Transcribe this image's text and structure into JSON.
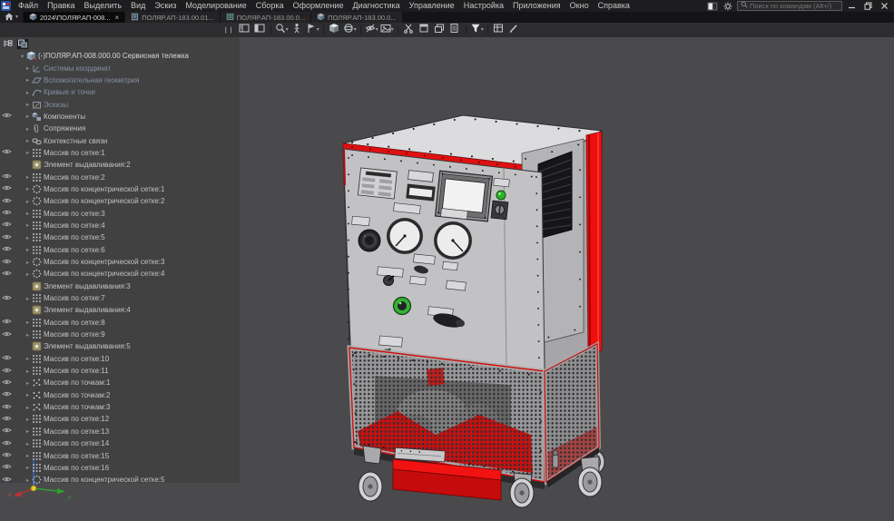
{
  "window": {
    "menu": [
      "Файл",
      "Правка",
      "Выделить",
      "Вид",
      "Эскиз",
      "Моделирование",
      "Сборка",
      "Оформление",
      "Диагностика",
      "Управление",
      "Настройка",
      "Приложения",
      "Окно",
      "Справка"
    ],
    "search": {
      "placeholder": "Поиск по командам (Alt+/)",
      "icon": "search-icon"
    },
    "titlebar_icons": [
      {
        "name": "layout-toggle-icon"
      },
      {
        "name": "settings-gear-icon"
      }
    ],
    "controls": [
      {
        "name": "minimize-icon"
      },
      {
        "name": "maximize-icon"
      },
      {
        "name": "close-icon"
      }
    ]
  },
  "tabs": {
    "home_icon": "home-icon",
    "items": [
      {
        "label": "2024\\ПОЛЯР.АП-008...",
        "icon": "assembly-doc-icon",
        "active": true,
        "close_glyph": "×"
      },
      {
        "label": "ПОЛЯР.АП-183.00.01...",
        "icon": "part-doc-icon",
        "active": false
      },
      {
        "label": "ПОЛЯР.АП-183.00.0...",
        "icon": "drawing-doc-icon",
        "active": false
      },
      {
        "label": "ПОЛЯР.АП-183.00.0...",
        "icon": "assembly-doc-icon",
        "active": false
      }
    ]
  },
  "toolbar": {
    "items": [
      {
        "name": "panel-drag-handle",
        "handle": true
      },
      {
        "name": "tree-panel-icon"
      },
      {
        "name": "graphic-layout-icon"
      },
      {
        "sep": true
      },
      {
        "name": "zoom-icon",
        "caret": true
      },
      {
        "name": "walk-icon"
      },
      {
        "name": "orientation-arrow-icon",
        "caret": true
      },
      {
        "sep": true
      },
      {
        "name": "shaded-cube-icon"
      },
      {
        "name": "orbit-sphere-icon",
        "caret": true
      },
      {
        "sep": true
      },
      {
        "name": "hide-objects-eye-icon",
        "caret": true
      },
      {
        "name": "snapshot-image-icon",
        "caret": true
      },
      {
        "sep": true
      },
      {
        "name": "explode-scissors-icon"
      },
      {
        "name": "window-new-icon"
      },
      {
        "name": "window-cascade-icon"
      },
      {
        "name": "window-docs-icon"
      },
      {
        "sep": true
      },
      {
        "name": "filter-funnel-icon",
        "caret": true
      },
      {
        "sep": true
      },
      {
        "name": "properties-table-icon"
      },
      {
        "name": "style-pencil-icon"
      }
    ]
  },
  "tree": {
    "header_icons": [
      {
        "name": "tree-structure-toggle-icon",
        "active": false
      },
      {
        "name": "tree-composition-toggle-icon",
        "active": true
      }
    ],
    "items": [
      {
        "label": "(-)ПОЛЯР.АП-008.000.00 Сервисная тележка",
        "icon": "assembly-icon",
        "root": true,
        "arrow": "down",
        "eye": false,
        "dimmed": false
      },
      {
        "label": "Системы координат",
        "icon": "coordinate-systems-icon",
        "arrow": "right",
        "eye": false,
        "dimmed": true
      },
      {
        "label": "Вспомогательная геометрия",
        "icon": "aux-geometry-icon",
        "arrow": "right",
        "eye": false,
        "dimmed": true
      },
      {
        "label": "Кривые и точки",
        "icon": "curves-points-icon",
        "arrow": "right",
        "eye": false,
        "dimmed": true
      },
      {
        "label": "Эскизы",
        "icon": "sketches-icon",
        "arrow": "right",
        "eye": false,
        "dimmed": true
      },
      {
        "label": "Компоненты",
        "icon": "components-icon",
        "arrow": "right",
        "eye": true,
        "dimmed": false
      },
      {
        "label": "Сопряжения",
        "icon": "mates-icon",
        "arrow": "right",
        "eye": false,
        "dimmed": false
      },
      {
        "label": "Контекстные связи",
        "icon": "context-links-icon",
        "arrow": "right",
        "eye": false,
        "dimmed": false
      },
      {
        "label": "Массив по сетке:1",
        "icon": "grid-array-icon",
        "arrow": "right",
        "eye": true,
        "dimmed": false
      },
      {
        "label": "Элемент выдавливания:2",
        "icon": "extrude-icon",
        "arrow": null,
        "eye": false,
        "dimmed": false
      },
      {
        "label": "Массив по сетке:2",
        "icon": "grid-array-icon",
        "arrow": "right",
        "eye": true,
        "dimmed": false
      },
      {
        "label": "Массив по концентрической сетке:1",
        "icon": "concentric-array-icon",
        "arrow": "right",
        "eye": true,
        "dimmed": false
      },
      {
        "label": "Массив по концентрической сетке:2",
        "icon": "concentric-array-icon",
        "arrow": "right",
        "eye": true,
        "dimmed": false
      },
      {
        "label": "Массив по сетке:3",
        "icon": "grid-array-icon",
        "arrow": "right",
        "eye": true,
        "dimmed": false
      },
      {
        "label": "Массив по сетке:4",
        "icon": "grid-array-icon",
        "arrow": "right",
        "eye": true,
        "dimmed": false
      },
      {
        "label": "Массив по сетке:5",
        "icon": "grid-array-icon",
        "arrow": "right",
        "eye": true,
        "dimmed": false
      },
      {
        "label": "Массив по сетке:6",
        "icon": "grid-array-icon",
        "arrow": "right",
        "eye": true,
        "dimmed": false
      },
      {
        "label": "Массив по концентрической сетке:3",
        "icon": "concentric-array-icon",
        "arrow": "right",
        "eye": true,
        "dimmed": false
      },
      {
        "label": "Массив по концентрической сетке:4",
        "icon": "concentric-array-icon",
        "arrow": "right",
        "eye": true,
        "dimmed": false
      },
      {
        "label": "Элемент выдавливания:3",
        "icon": "extrude-icon",
        "arrow": null,
        "eye": false,
        "dimmed": false
      },
      {
        "label": "Массив по сетке:7",
        "icon": "grid-array-icon",
        "arrow": "right",
        "eye": true,
        "dimmed": false
      },
      {
        "label": "Элемент выдавливания:4",
        "icon": "extrude-icon",
        "arrow": null,
        "eye": false,
        "dimmed": false
      },
      {
        "label": "Массив по сетке:8",
        "icon": "grid-array-icon",
        "arrow": "right",
        "eye": true,
        "dimmed": false
      },
      {
        "label": "Массив по сетке:9",
        "icon": "grid-array-icon",
        "arrow": "right",
        "eye": true,
        "dimmed": false
      },
      {
        "label": "Элемент выдавливания:5",
        "icon": "extrude-icon",
        "arrow": null,
        "eye": false,
        "dimmed": false
      },
      {
        "label": "Массив по сетке:10",
        "icon": "grid-array-icon",
        "arrow": "right",
        "eye": true,
        "dimmed": false
      },
      {
        "label": "Массив по сетке:11",
        "icon": "grid-array-icon",
        "arrow": "right",
        "eye": true,
        "dimmed": false
      },
      {
        "label": "Массив по точкам:1",
        "icon": "point-array-icon",
        "arrow": "right",
        "eye": true,
        "dimmed": false
      },
      {
        "label": "Массив по точкам:2",
        "icon": "point-array-icon",
        "arrow": "right",
        "eye": true,
        "dimmed": false
      },
      {
        "label": "Массив по точкам:3",
        "icon": "point-array-icon",
        "arrow": "right",
        "eye": true,
        "dimmed": false
      },
      {
        "label": "Массив по сетке:12",
        "icon": "grid-array-icon",
        "arrow": "right",
        "eye": true,
        "dimmed": false
      },
      {
        "label": "Массив по сетке:13",
        "icon": "grid-array-icon",
        "arrow": "right",
        "eye": true,
        "dimmed": false
      },
      {
        "label": "Массив по сетке:14",
        "icon": "grid-array-icon",
        "arrow": "right",
        "eye": true,
        "dimmed": false
      },
      {
        "label": "Массив по сетке:15",
        "icon": "grid-array-icon",
        "arrow": "right",
        "eye": true,
        "dimmed": false
      },
      {
        "label": "Массив по сетке:16",
        "icon": "grid-array-icon",
        "arrow": "right",
        "eye": true,
        "dimmed": false
      },
      {
        "label": "Массив по концентрической сетке:5",
        "icon": "concentric-array-icon",
        "arrow": "right",
        "eye": true,
        "dimmed": false
      }
    ]
  },
  "viewport": {
    "background": "#4a4a4c",
    "accent_red": "#e31313",
    "cabinet_grey": "#c4c4c6",
    "lamp_green": "#2db42d",
    "triad": {
      "x_label": "x"
    }
  }
}
